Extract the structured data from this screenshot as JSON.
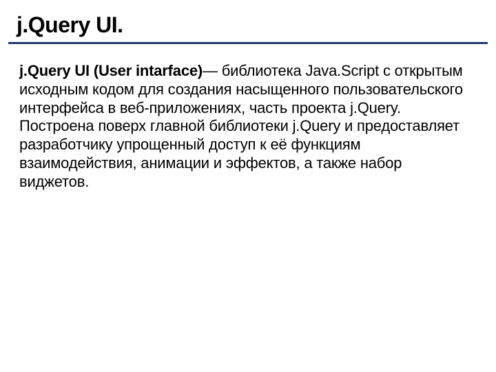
{
  "slide": {
    "title": "j.Query UI.",
    "body_lead": "j.Query UI (User intarface)",
    "body_rest": "— библиотека Java.Script с открытым исходным кодом для создания насыщенного пользовательского интерфейса в веб-приложениях, часть проекта j.Query. Построена поверх главной библиотеки j.Query и предоставляет разработчику упрощенный доступ к её функциям взаимодействия, анимации и эффектов, а также набор виджетов."
  }
}
